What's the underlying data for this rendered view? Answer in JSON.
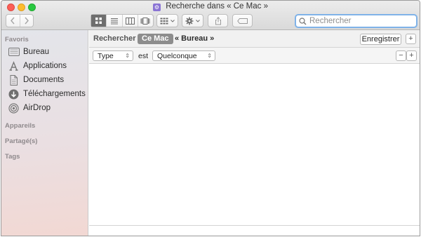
{
  "window": {
    "title": "Recherche dans « Ce Mac »",
    "title_icon": "folder-search-icon"
  },
  "toolbar": {
    "back_icon": "chevron-left-icon",
    "forward_icon": "chevron-right-icon",
    "views": [
      {
        "name": "icon-view",
        "active": true
      },
      {
        "name": "list-view",
        "active": false
      },
      {
        "name": "column-view",
        "active": false
      },
      {
        "name": "cover-flow-view",
        "active": false
      }
    ],
    "arrange_icon": "grid-arrange-icon",
    "action_icon": "gear-icon",
    "share_icon": "share-icon",
    "tag_icon": "tag-icon"
  },
  "search": {
    "placeholder": "Rechercher",
    "value": ""
  },
  "sidebar": {
    "sections": [
      {
        "title": "Favoris",
        "items": [
          {
            "label": "Bureau",
            "icon": "desktop-icon"
          },
          {
            "label": "Applications",
            "icon": "applications-icon"
          },
          {
            "label": "Documents",
            "icon": "documents-icon"
          },
          {
            "label": "Téléchargements",
            "icon": "downloads-icon"
          },
          {
            "label": "AirDrop",
            "icon": "airdrop-icon"
          }
        ]
      },
      {
        "title": "Appareils",
        "items": []
      },
      {
        "title": "Partagé(s)",
        "items": []
      },
      {
        "title": "Tags",
        "items": []
      }
    ]
  },
  "scope": {
    "label": "Rechercher :",
    "active": "Ce Mac",
    "other": "« Bureau »",
    "save_label": "Enregistrer",
    "add_label": "+"
  },
  "criteria": {
    "attribute": "Type",
    "operator": "est",
    "value": "Quelconque",
    "remove_label": "−",
    "add_label": "+"
  },
  "colors": {
    "accent_focus": "#7fb2e8",
    "scope_active_bg": "#8d8d8d"
  }
}
